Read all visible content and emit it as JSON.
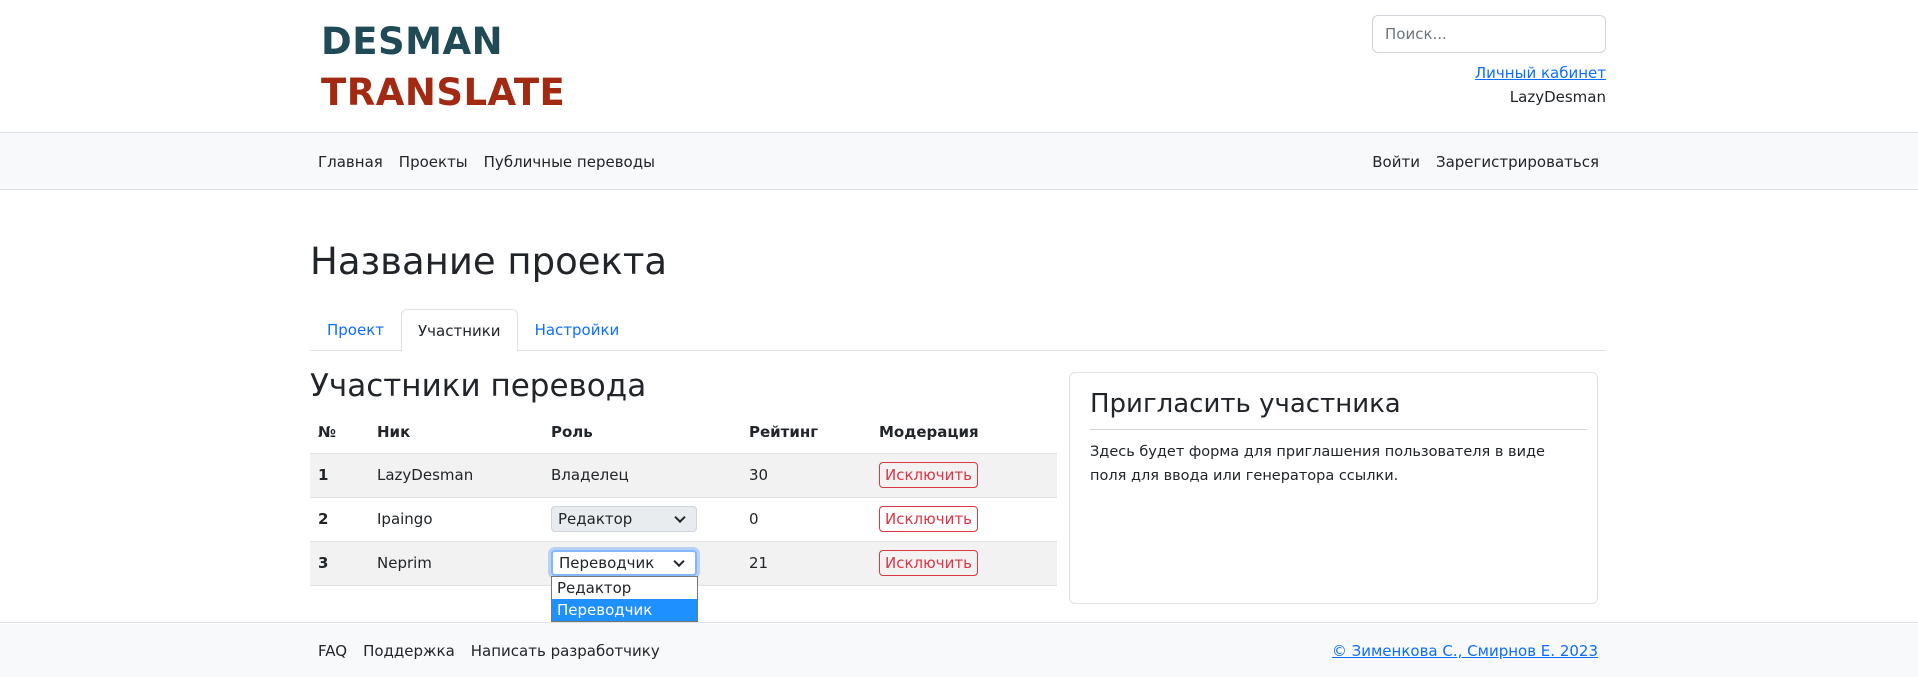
{
  "header": {
    "logo_line1": "DESMAN",
    "logo_line2": "TRANSLATE",
    "search_placeholder": "Поиск...",
    "cabinet_link": "Личный кабинет",
    "username": "LazyDesman"
  },
  "nav": {
    "left": [
      "Главная",
      "Проекты",
      "Публичные переводы"
    ],
    "right": [
      "Войти",
      "Зарегистрироваться"
    ]
  },
  "page": {
    "title": "Название проекта",
    "tabs": [
      {
        "label": "Проект",
        "active": false
      },
      {
        "label": "Участники",
        "active": true
      },
      {
        "label": "Настройки",
        "active": false
      }
    ]
  },
  "members": {
    "title": "Участники перевода",
    "columns": [
      "№",
      "Ник",
      "Роль",
      "Рейтинг",
      "Модерация"
    ],
    "rows": [
      {
        "num": "1",
        "nick": "LazyDesman",
        "role": "Владелец",
        "role_type": "text",
        "rating": "30",
        "action": "Исключить"
      },
      {
        "num": "2",
        "nick": "Ipaingo",
        "role": "Редактор",
        "role_type": "select",
        "rating": "0",
        "action": "Исключить"
      },
      {
        "num": "3",
        "nick": "Neprim",
        "role": "Переводчик",
        "role_type": "select-open",
        "rating": "21",
        "action": "Исключить"
      }
    ],
    "dropdown_options": [
      "Редактор",
      "Переводчик"
    ],
    "dropdown_selected": "Переводчик"
  },
  "invite": {
    "title": "Пригласить участника",
    "text": "Здесь будет форма для приглашения пользователя в виде поля для ввода или генератора ссылки."
  },
  "footer": {
    "links": [
      "FAQ",
      "Поддержка",
      "Написать разработчику"
    ],
    "copyright": "© Зименкова С., Смирнов Е. 2023"
  },
  "colors": {
    "logo_dark": "#1f4a56",
    "logo_red": "#a32a12",
    "link": "#0d6efd",
    "danger": "#dc3545",
    "selected_option": "#1e90ff"
  }
}
